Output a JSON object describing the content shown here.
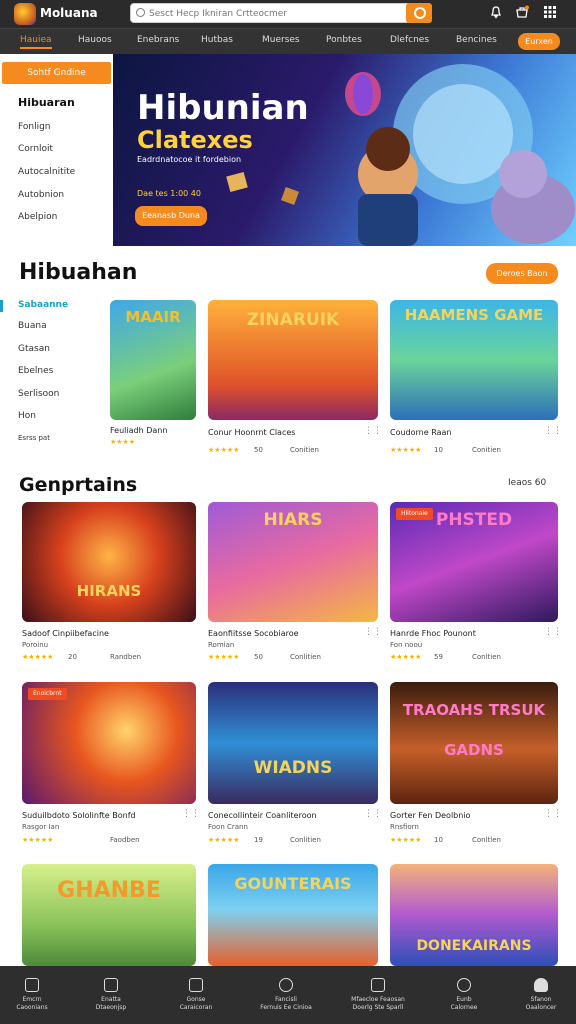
{
  "header": {
    "brand": "Moluana",
    "search_placeholder": "Sesct Hecp Ikniran Crtteocmer",
    "icons": [
      "bell-icon",
      "cart-icon",
      "grid-menu-icon"
    ]
  },
  "nav": {
    "items": [
      "Hauiea",
      "Hauoos",
      "Enebrans",
      "Hutbas",
      "Muerses",
      "Ponbtes",
      "Dlefcnes",
      "Bencines"
    ],
    "cta": "Eurxen"
  },
  "sidebar": {
    "header": "Sohtf Gndine",
    "items": [
      "Hibuaran",
      "Fonlign",
      "Cornloit",
      "Autocalnitite",
      "Autobnion",
      "Abelpion"
    ]
  },
  "hero": {
    "title": "Hibunian",
    "subtitle": "Clatexes",
    "tagline": "Eadrdnatocoe it fordebion",
    "meta": "Dae tes 1:00 40",
    "button": "Eeanasb Duna"
  },
  "section1": {
    "title": "Hibuahan",
    "button": "Deroes Baon",
    "categories": [
      "Sabaanne",
      "Buana",
      "Gtasan",
      "Ebelnes",
      "Serlisoon",
      "Hon",
      "Esrss pat"
    ]
  },
  "section2": {
    "title": "Genprtains",
    "see_more": "Ieaos 60"
  },
  "featured_cards": [
    {
      "thumb": "MAAIR",
      "title": "Feuliadh Dann",
      "stars": "★★★★",
      "rating": "",
      "meta": ""
    },
    {
      "thumb": "ZINARUIK",
      "title": "Conur Hoonrnt Claces",
      "stars": "★★★★★",
      "rating": "50",
      "meta": "Conitien"
    },
    {
      "thumb": "HAAMENS GAME",
      "title": "Coudorne Raan",
      "stars": "★★★★★",
      "rating": "10",
      "meta": "Conitien"
    }
  ],
  "grid_cards": [
    {
      "thumb": "HIRANS",
      "title": "Sadoof Cinpiibefacine",
      "sub": "Poroinu",
      "stars": "★★★★★",
      "rating": "20",
      "meta": "Randben",
      "badge": ""
    },
    {
      "thumb": "HIARS",
      "title": "Eaonfiitsse Socobiaroe",
      "sub": "Romian",
      "stars": "★★★★★",
      "rating": "50",
      "meta": "Conlitien",
      "badge": ""
    },
    {
      "thumb": "PHSTED",
      "title": "Hanrde Fhoc Pounont",
      "sub": "Fon noou",
      "stars": "★★★★★",
      "rating": "59",
      "meta": "Conltien",
      "badge": "Hlitonaie"
    },
    {
      "thumb": "",
      "title": "Suduilbdoto Sololinfte Bonfd",
      "sub": "Rasgor Ian",
      "stars": "★★★★★",
      "rating": "",
      "meta": "Faodben",
      "badge": "Enoicbrnt"
    },
    {
      "thumb": "WIADNS",
      "title": "Conecollinteir Coanliteroon",
      "sub": "Foon Crann",
      "stars": "★★★★★",
      "rating": "19",
      "meta": "Conlitien",
      "badge": ""
    },
    {
      "thumb": "TRAOAHS TRSUK GADNS",
      "title": "Gorter Fen Deolbnio",
      "sub": "Rnsfiorn",
      "stars": "★★★★★",
      "rating": "10",
      "meta": "Conltlen",
      "badge": ""
    },
    {
      "thumb": "GHANBE",
      "title": "",
      "sub": "",
      "stars": "",
      "rating": "",
      "meta": "",
      "badge": ""
    },
    {
      "thumb": "GOUNTERAIS",
      "title": "",
      "sub": "",
      "stars": "",
      "rating": "",
      "meta": "",
      "badge": ""
    },
    {
      "thumb": "DONEKAIRANS",
      "title": "",
      "sub": "",
      "stars": "",
      "rating": "",
      "meta": "",
      "badge": ""
    }
  ],
  "tabbar": [
    {
      "icon": "home-icon",
      "l1": "Emcrn",
      "l2": "Caoonians"
    },
    {
      "icon": "book-icon",
      "l1": "Enatta",
      "l2": "Dtaeonjsp"
    },
    {
      "icon": "house-icon",
      "l1": "Gonse",
      "l2": "Caraicoran"
    },
    {
      "icon": "user-icon",
      "l1": "Fancisli",
      "l2": "Fernuis Ee Cinioa"
    },
    {
      "icon": "list-icon",
      "l1": "Mfaecloe Feaosan",
      "l2": "Doerlg Ste Sparll"
    },
    {
      "icon": "apple-icon",
      "l1": "Eunb",
      "l2": "Calornee"
    },
    {
      "icon": "profile-icon",
      "l1": "Sfanon",
      "l2": "Oaaloncer"
    }
  ]
}
